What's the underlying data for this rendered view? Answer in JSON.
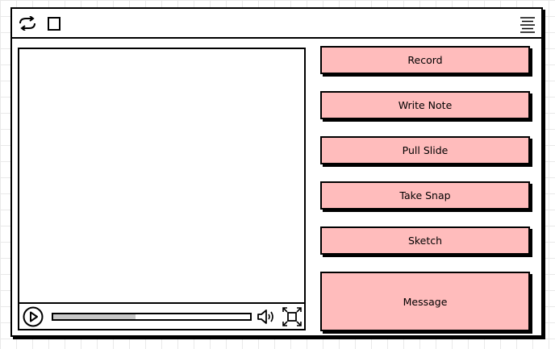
{
  "titlebar": {
    "icons": [
      "refresh-icon",
      "stop-icon",
      "hamburger-menu-icon"
    ]
  },
  "player": {
    "progress_fraction": 0.42,
    "icons": [
      "play-icon",
      "volume-icon",
      "fullscreen-icon"
    ]
  },
  "actions": {
    "record_label": "Record",
    "write_note_label": "Write Note",
    "pull_slide_label": "Pull Slide",
    "take_snap_label": "Take Snap",
    "sketch_label": "Sketch",
    "message_label": "Message"
  },
  "colors": {
    "button_fill": "#ffbcbc",
    "stroke": "#000000",
    "progress_fill": "#c8c8c8"
  }
}
